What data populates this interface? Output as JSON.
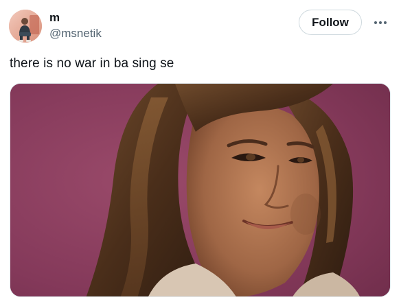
{
  "author": {
    "display_name": "m",
    "handle": "@msnetik"
  },
  "actions": {
    "follow_label": "Follow",
    "more_icon": "more-horizontal-icon"
  },
  "tweet": {
    "text": "there is no war in ba sing se"
  },
  "colors": {
    "text_primary": "#0f1419",
    "text_secondary": "#536471",
    "button_border": "#cfd9de",
    "media_background": "#7a3652"
  }
}
